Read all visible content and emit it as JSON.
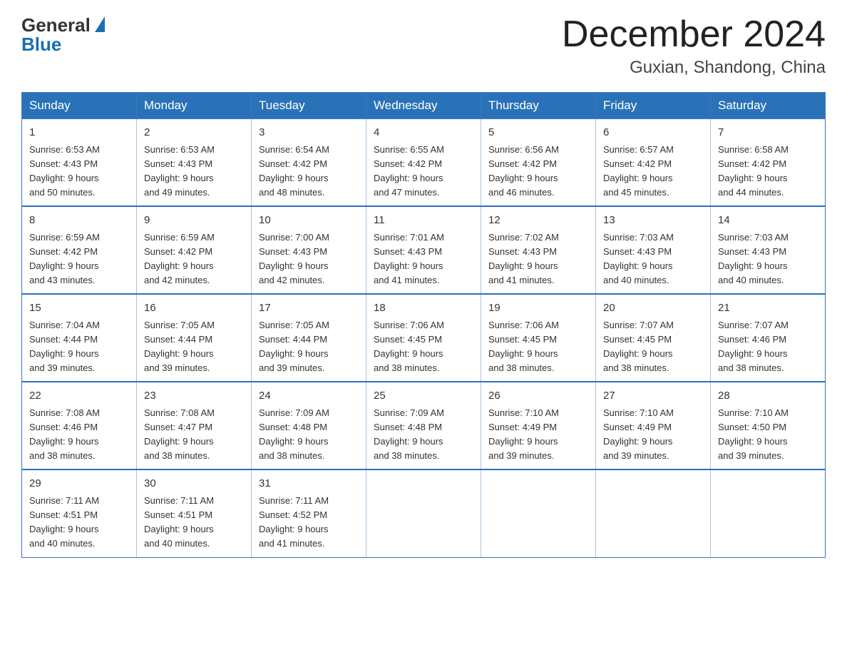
{
  "header": {
    "logo": {
      "general": "General",
      "blue": "Blue"
    },
    "title": "December 2024",
    "location": "Guxian, Shandong, China"
  },
  "weekdays": [
    "Sunday",
    "Monday",
    "Tuesday",
    "Wednesday",
    "Thursday",
    "Friday",
    "Saturday"
  ],
  "weeks": [
    [
      {
        "day": 1,
        "sunrise": "6:53 AM",
        "sunset": "4:43 PM",
        "daylight_hours": 9,
        "daylight_minutes": 50
      },
      {
        "day": 2,
        "sunrise": "6:53 AM",
        "sunset": "4:43 PM",
        "daylight_hours": 9,
        "daylight_minutes": 49
      },
      {
        "day": 3,
        "sunrise": "6:54 AM",
        "sunset": "4:42 PM",
        "daylight_hours": 9,
        "daylight_minutes": 48
      },
      {
        "day": 4,
        "sunrise": "6:55 AM",
        "sunset": "4:42 PM",
        "daylight_hours": 9,
        "daylight_minutes": 47
      },
      {
        "day": 5,
        "sunrise": "6:56 AM",
        "sunset": "4:42 PM",
        "daylight_hours": 9,
        "daylight_minutes": 46
      },
      {
        "day": 6,
        "sunrise": "6:57 AM",
        "sunset": "4:42 PM",
        "daylight_hours": 9,
        "daylight_minutes": 45
      },
      {
        "day": 7,
        "sunrise": "6:58 AM",
        "sunset": "4:42 PM",
        "daylight_hours": 9,
        "daylight_minutes": 44
      }
    ],
    [
      {
        "day": 8,
        "sunrise": "6:59 AM",
        "sunset": "4:42 PM",
        "daylight_hours": 9,
        "daylight_minutes": 43
      },
      {
        "day": 9,
        "sunrise": "6:59 AM",
        "sunset": "4:42 PM",
        "daylight_hours": 9,
        "daylight_minutes": 42
      },
      {
        "day": 10,
        "sunrise": "7:00 AM",
        "sunset": "4:43 PM",
        "daylight_hours": 9,
        "daylight_minutes": 42
      },
      {
        "day": 11,
        "sunrise": "7:01 AM",
        "sunset": "4:43 PM",
        "daylight_hours": 9,
        "daylight_minutes": 41
      },
      {
        "day": 12,
        "sunrise": "7:02 AM",
        "sunset": "4:43 PM",
        "daylight_hours": 9,
        "daylight_minutes": 41
      },
      {
        "day": 13,
        "sunrise": "7:03 AM",
        "sunset": "4:43 PM",
        "daylight_hours": 9,
        "daylight_minutes": 40
      },
      {
        "day": 14,
        "sunrise": "7:03 AM",
        "sunset": "4:43 PM",
        "daylight_hours": 9,
        "daylight_minutes": 40
      }
    ],
    [
      {
        "day": 15,
        "sunrise": "7:04 AM",
        "sunset": "4:44 PM",
        "daylight_hours": 9,
        "daylight_minutes": 39
      },
      {
        "day": 16,
        "sunrise": "7:05 AM",
        "sunset": "4:44 PM",
        "daylight_hours": 9,
        "daylight_minutes": 39
      },
      {
        "day": 17,
        "sunrise": "7:05 AM",
        "sunset": "4:44 PM",
        "daylight_hours": 9,
        "daylight_minutes": 39
      },
      {
        "day": 18,
        "sunrise": "7:06 AM",
        "sunset": "4:45 PM",
        "daylight_hours": 9,
        "daylight_minutes": 38
      },
      {
        "day": 19,
        "sunrise": "7:06 AM",
        "sunset": "4:45 PM",
        "daylight_hours": 9,
        "daylight_minutes": 38
      },
      {
        "day": 20,
        "sunrise": "7:07 AM",
        "sunset": "4:45 PM",
        "daylight_hours": 9,
        "daylight_minutes": 38
      },
      {
        "day": 21,
        "sunrise": "7:07 AM",
        "sunset": "4:46 PM",
        "daylight_hours": 9,
        "daylight_minutes": 38
      }
    ],
    [
      {
        "day": 22,
        "sunrise": "7:08 AM",
        "sunset": "4:46 PM",
        "daylight_hours": 9,
        "daylight_minutes": 38
      },
      {
        "day": 23,
        "sunrise": "7:08 AM",
        "sunset": "4:47 PM",
        "daylight_hours": 9,
        "daylight_minutes": 38
      },
      {
        "day": 24,
        "sunrise": "7:09 AM",
        "sunset": "4:48 PM",
        "daylight_hours": 9,
        "daylight_minutes": 38
      },
      {
        "day": 25,
        "sunrise": "7:09 AM",
        "sunset": "4:48 PM",
        "daylight_hours": 9,
        "daylight_minutes": 38
      },
      {
        "day": 26,
        "sunrise": "7:10 AM",
        "sunset": "4:49 PM",
        "daylight_hours": 9,
        "daylight_minutes": 39
      },
      {
        "day": 27,
        "sunrise": "7:10 AM",
        "sunset": "4:49 PM",
        "daylight_hours": 9,
        "daylight_minutes": 39
      },
      {
        "day": 28,
        "sunrise": "7:10 AM",
        "sunset": "4:50 PM",
        "daylight_hours": 9,
        "daylight_minutes": 39
      }
    ],
    [
      {
        "day": 29,
        "sunrise": "7:11 AM",
        "sunset": "4:51 PM",
        "daylight_hours": 9,
        "daylight_minutes": 40
      },
      {
        "day": 30,
        "sunrise": "7:11 AM",
        "sunset": "4:51 PM",
        "daylight_hours": 9,
        "daylight_minutes": 40
      },
      {
        "day": 31,
        "sunrise": "7:11 AM",
        "sunset": "4:52 PM",
        "daylight_hours": 9,
        "daylight_minutes": 41
      },
      null,
      null,
      null,
      null
    ]
  ]
}
